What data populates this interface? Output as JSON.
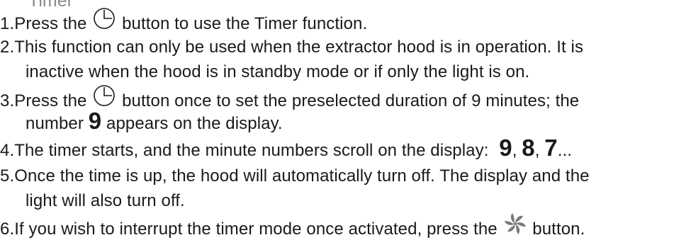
{
  "heading": "Timer",
  "icons": {
    "timer": "timer-clock-icon",
    "fan": "fan-icon"
  },
  "items": [
    {
      "num": "1.",
      "before": "Press the",
      "after": "button to use the Timer function."
    },
    {
      "num": "2.",
      "line1": "This function can only be used when the extractor hood is in operation. It is",
      "line2": "inactive when the hood is in standby mode or if only the light is on."
    },
    {
      "num": "3.",
      "before": "Press the",
      "after": "button once to set the preselected duration of 9 minutes; the",
      "line2a": "number",
      "big": "9",
      "line2b": "appears on the display."
    },
    {
      "num": "4.",
      "text": "The timer starts, and the minute numbers scroll on the display:",
      "seq": [
        "9",
        "8",
        "7"
      ],
      "sep": ",",
      "ellipsis": "..."
    },
    {
      "num": "5.",
      "line1": "Once the time is up, the hood will automatically turn off. The display and the",
      "line2": "light will also turn off."
    },
    {
      "num": "6.",
      "before": "If you wish to interrupt the timer mode once activated, press the",
      "after": "button."
    }
  ]
}
